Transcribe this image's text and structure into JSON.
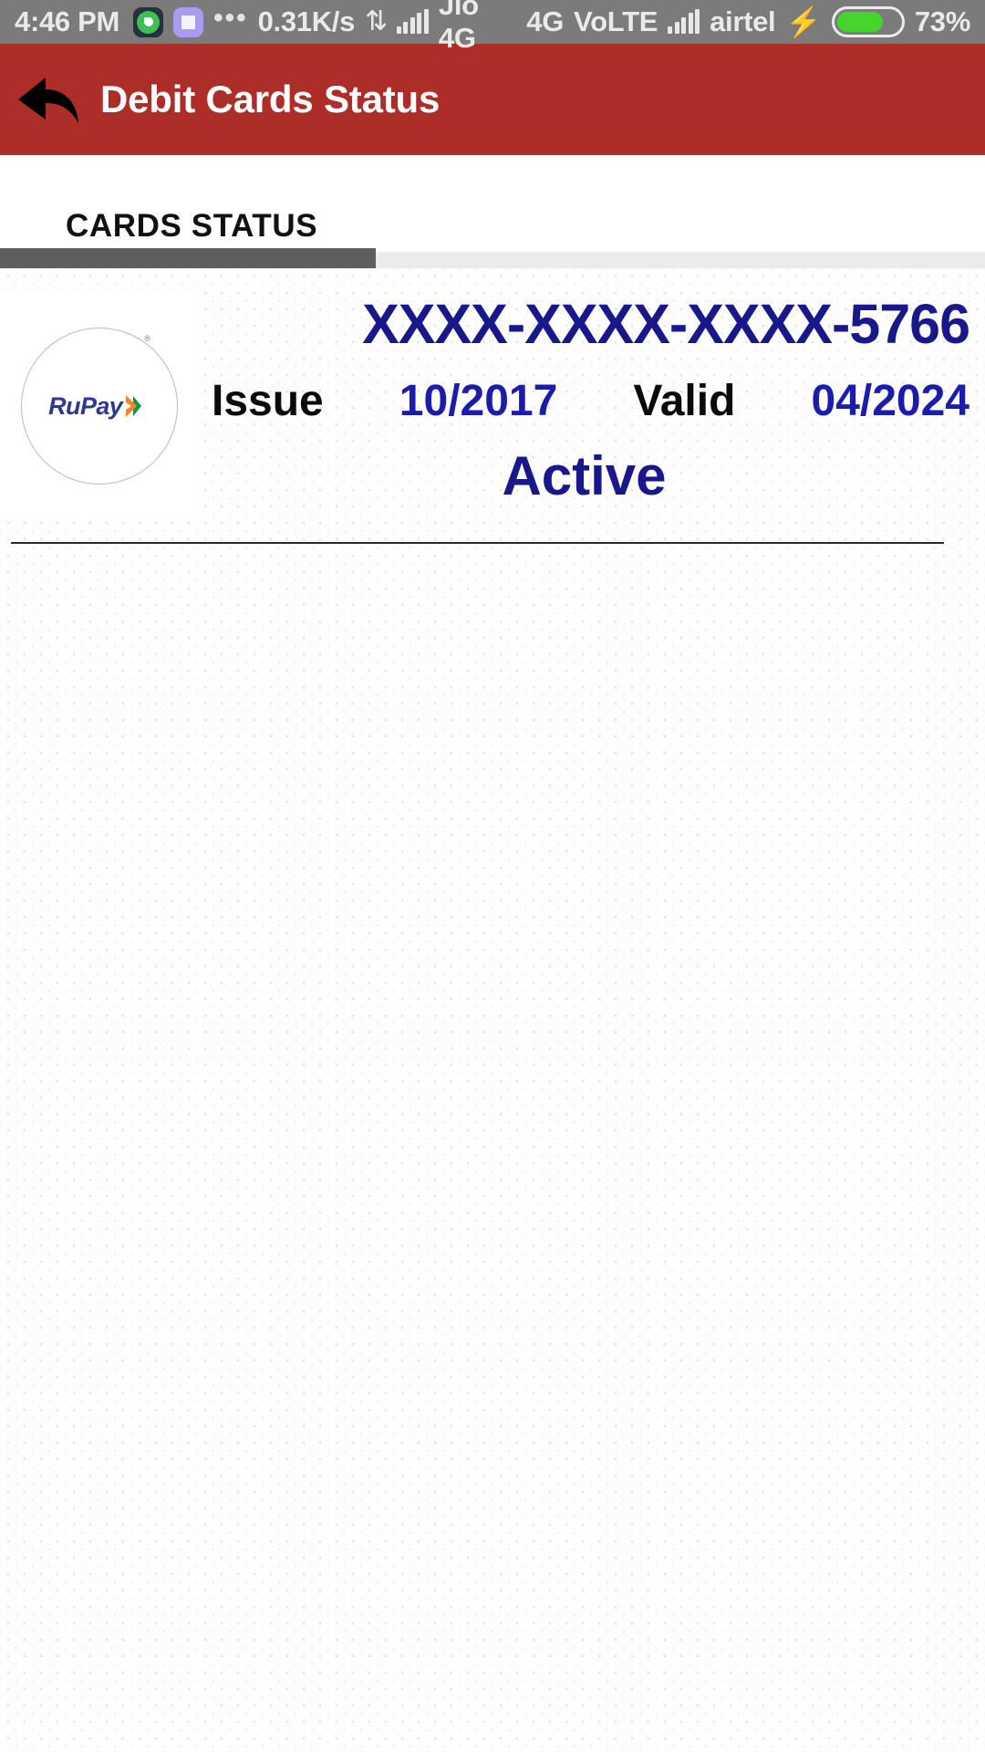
{
  "statusbar": {
    "time": "4:46 PM",
    "whatsapp_icon": "whatsapp-icon",
    "app_icon": "purple-app-icon",
    "overflow_icon": "•••",
    "network_speed": "0.31K/s",
    "sync_icon": "⇅",
    "sim1_signal_icon": "signal-bars-icon",
    "sim1_label": "Jio 4G",
    "network_type": "4G",
    "volte_label": "VoLTE",
    "sim2_signal_icon": "signal-bars-icon",
    "sim2_label": "airtel",
    "charging_icon": "⚡",
    "battery_percent": "73%"
  },
  "appbar": {
    "back_icon": "back-arrow-icon",
    "title": "Debit Cards Status",
    "background_color": "#ad2e29"
  },
  "tabs": {
    "items": [
      {
        "label": "CARDS STATUS",
        "selected": true
      }
    ],
    "indicator_color": "#5e5e5e"
  },
  "card": {
    "brand_logo": "rupay-logo",
    "brand_name": "RuPay",
    "registered_mark": "®",
    "number": "XXXX-XXXX-XXXX-5766",
    "issue_label": "Issue",
    "issue_value": "10/2017",
    "valid_label": "Valid",
    "valid_value": "04/2024",
    "status": "Active",
    "number_color": "#18188c",
    "status_color": "#18188c"
  }
}
